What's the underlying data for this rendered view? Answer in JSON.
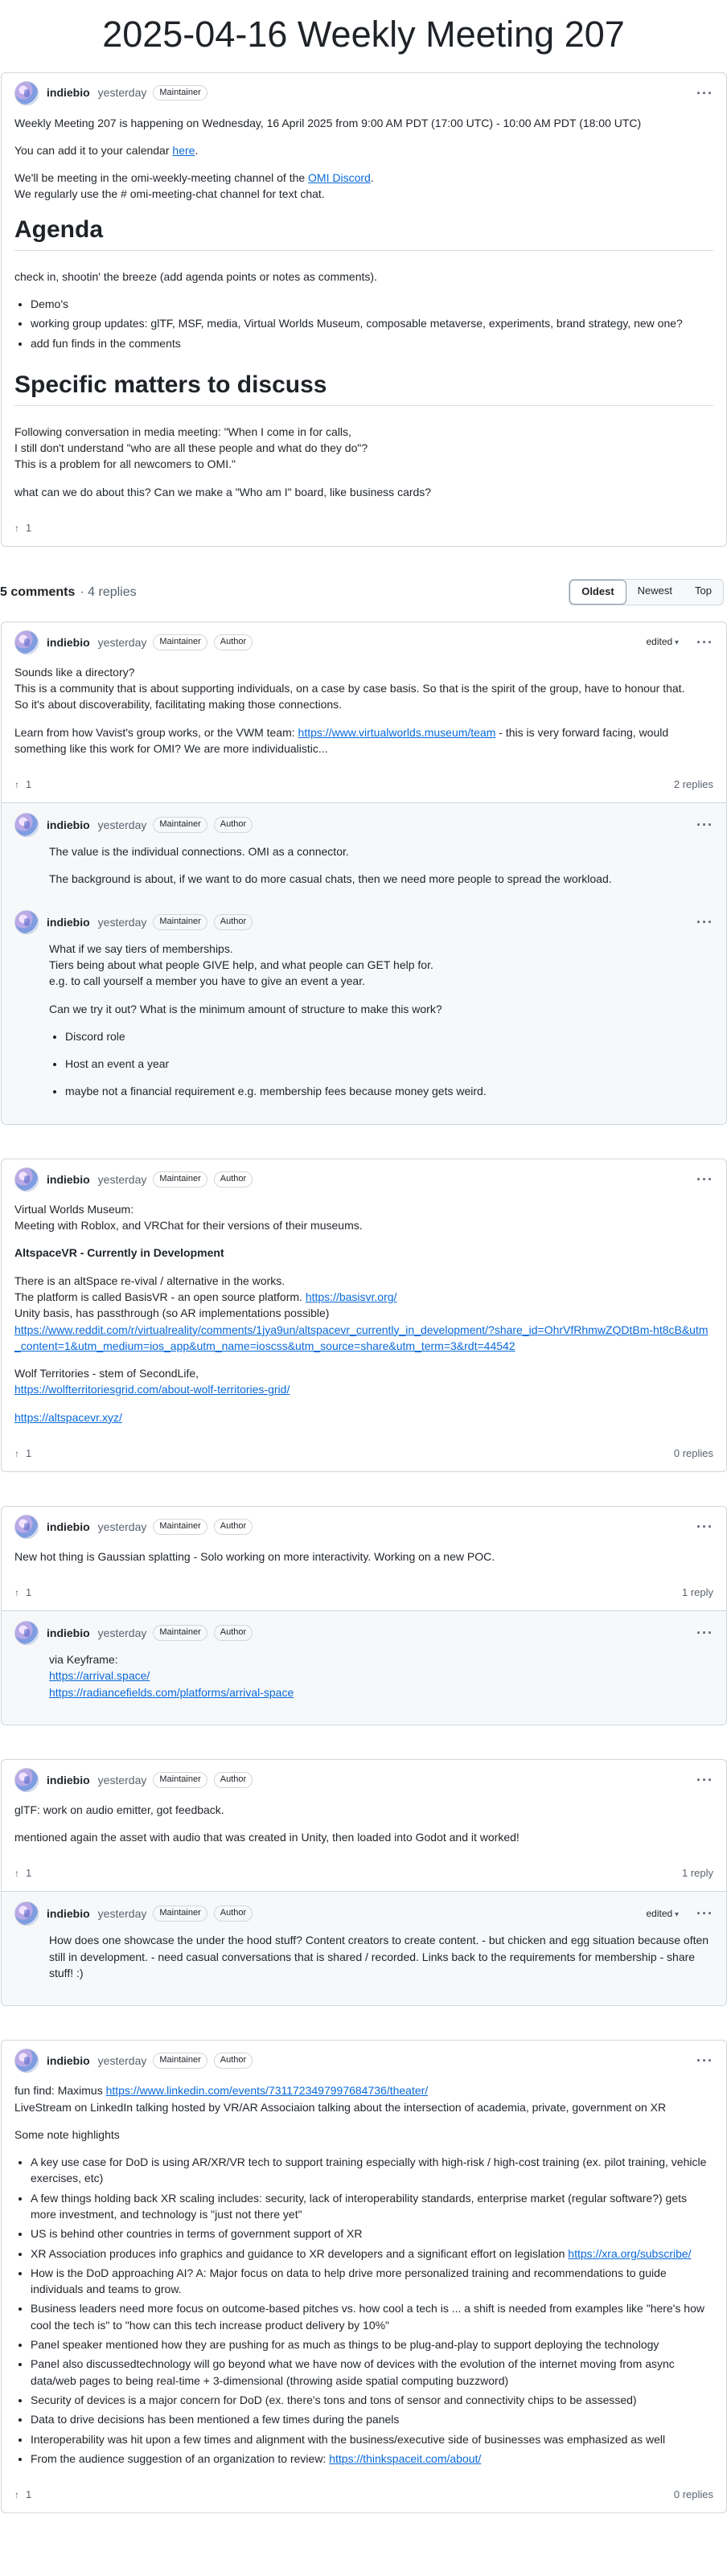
{
  "page_title": "2025-04-16 Weekly Meeting 207",
  "icons": {
    "upvote": "arrow-up-icon",
    "menu": "kebab-menu-icon",
    "avatar": "user-avatar"
  },
  "main": {
    "user": "indiebio",
    "time": "yesterday",
    "badge_maintainer": "Maintainer",
    "p1": "Weekly Meeting 207 is happening on Wednesday, 16 April 2025 from 9:00 AM PDT (17:00 UTC) - 10:00 AM PDT (18:00 UTC)",
    "p2_pre": "You can add it to your calendar ",
    "p2_link": "here",
    "p2_post": ".",
    "p3_pre": "We'll be meeting in the omi-weekly-meeting channel of the ",
    "p3_link": "OMI Discord",
    "p3_post": ".",
    "p3_line2": "We regularly use the # omi-meeting-chat channel for text chat.",
    "agenda_h": "Agenda",
    "agenda_intro": "check in, shootin' the breeze (add agenda points or notes as comments).",
    "agenda_items": [
      "Demo's",
      "working group updates: glTF, MSF, media, Virtual Worlds Museum, composable metaverse, experiments, brand strategy, new one?",
      "add fun finds in the comments"
    ],
    "specific_h": "Specific matters to discuss",
    "spec_l1": "Following conversation in media meeting: \"When I come in for calls,",
    "spec_l2": "I still don't understand \"who are all these people and what do they do\"?",
    "spec_l3": "This is a problem for all newcomers to OMI.\"",
    "spec_q": "what can we do about this? Can we make a \"Who am I\" board, like business cards?",
    "votes": "1"
  },
  "comments_bar": {
    "count": "5 comments",
    "replies": "· 4 replies",
    "sort": [
      "Oldest",
      "Newest",
      "Top"
    ]
  },
  "badge_author": "Author",
  "edited": "edited",
  "c1": {
    "l1": "Sounds like a directory?",
    "l2": "This is a community that is about supporting individuals, on a case by case basis. So that is the spirit of the group, have to honour that.",
    "l3": "So it's about discoverability, facilitating making those connections.",
    "p2_pre": "Learn from how Vavist's group works, or the VWM team: ",
    "p2_link": "https://www.virtualworlds.museum/team",
    "p2_post": " - this is very forward facing, would something like this work for OMI? We are more individualistic...",
    "votes": "1",
    "replies": "2 replies",
    "r1": {
      "p1": "The value is the individual connections. OMI as a connector.",
      "p2": "The background is about, if we want to do more casual chats, then we need more people to spread the workload."
    },
    "r2": {
      "l1": "What if we say tiers of memberships.",
      "l2": "Tiers being about what people GIVE help, and what people can GET help for.",
      "l3": "e.g. to call yourself a member you have to give an event a year.",
      "q": "Can we try it out? What is the minimum amount of structure to make this work?",
      "items": [
        "Discord role",
        "Host an event a year",
        "maybe not a financial requirement e.g. membership fees because money gets weird."
      ]
    }
  },
  "c2": {
    "l1": "Virtual Worlds Museum:",
    "l2": "Meeting with Roblox, and VRChat for their versions of their museums.",
    "h": "AltspaceVR - Currently in Development",
    "a1": "There is an altSpace re-vival / alternative in the works.",
    "a2_pre": "The platform is called BasisVR - an open source platform. ",
    "a2_link": "https://basisvr.org/",
    "a3": "Unity basis, has passthrough (so AR implementations possible)",
    "a4_link": "https://www.reddit.com/r/virtualreality/comments/1jya9un/altspacevr_currently_in_development/?share_id=OhrVfRhmwZQDtBm-ht8cB&utm_content=1&utm_medium=ios_app&utm_name=ioscss&utm_source=share&utm_term=3&rdt=44542",
    "w1": "Wolf Territories - stem of SecondLife,",
    "w2_link": "https://wolfterritoriesgrid.com/about-wolf-territories-grid/",
    "alt_link": "https://altspacevr.xyz/",
    "votes": "1",
    "replies": "0 replies"
  },
  "c3": {
    "p": "New hot thing is Gaussian splatting - Solo working on more interactivity. Working on a new POC.",
    "votes": "1",
    "replies": "1 reply",
    "r1": {
      "l1": "via Keyframe:",
      "link1": "https://arrival.space/",
      "link2": "https://radiancefields.com/platforms/arrival-space"
    }
  },
  "c4": {
    "p1": "glTF: work on audio emitter, got feedback.",
    "p2": "mentioned again the asset with audio that was created in Unity, then loaded into Godot and it worked!",
    "votes": "1",
    "replies": "1 reply",
    "r1": {
      "p": "How does one showcase the under the hood stuff? Content creators to create content. - but chicken and egg situation because often still in development. - need casual conversations that is shared / recorded. Links back to the requirements for membership - share stuff! :)"
    }
  },
  "c5": {
    "l1_pre": "fun find: Maximus ",
    "l1_link": "https://www.linkedin.com/events/7311723497997684736/theater/",
    "l2": "LiveStream on LinkedIn talking hosted by VR/AR Associaion talking about the intersection of academia, private, government on XR",
    "h": "Some note highlights",
    "items": [
      "A key use case for DoD is using AR/XR/VR tech to support training especially with high-risk / high-cost training (ex. pilot training, vehicle exercises, etc)",
      "A few things holding back XR scaling includes: security, lack of interoperability standards, enterprise market (regular software?) gets more investment, and technology is \"just not there yet\"",
      "US is behind other countries in terms of government support of XR",
      "XR Association produces info graphics and guidance to XR developers and a significant effort on legislation ",
      "How is the DoD approaching AI? A: Major focus on data to help drive more personalized training and recommendations to guide individuals and teams to grow.",
      "Business leaders need more focus on outcome-based pitches vs. how cool a tech is ... a shift is needed from examples like \"here's how cool the tech is\" to \"how can this tech increase product delivery by 10%\"",
      "Panel speaker mentioned how they are pushing for as much as things to be plug-and-play to support deploying the technology",
      "Panel also discussedtechnology will go beyond what we have now of devices with the evolution of the internet moving from async data/web pages to being real-time + 3-dimensional (throwing aside spatial computing buzzword)",
      "Security of devices is a major concern for DoD (ex. there's tons and tons of sensor and connectivity chips to be assessed)",
      "Data to drive decisions has been mentioned a few times during the panels",
      "Interoperability was hit upon a few times and alignment with the business/executive side of businesses was emphasized as well",
      "From the audience suggestion of an organization to review: "
    ],
    "xra_link": "https://xra.org/subscribe/",
    "think_link": "https://thinkspaceit.com/about/",
    "votes": "1",
    "replies": "0 replies"
  }
}
